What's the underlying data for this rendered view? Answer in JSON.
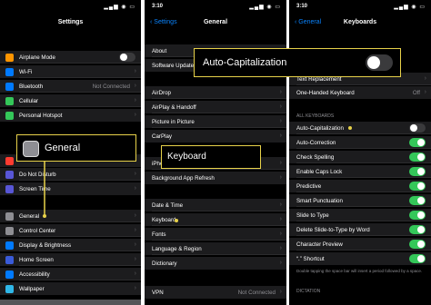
{
  "panel1": {
    "time": "",
    "title": "Settings",
    "group1": [
      {
        "label": "Airplane Mode",
        "icon": "airplane-icon",
        "color": "#ff9500",
        "toggle": "off"
      },
      {
        "label": "Wi-Fi",
        "icon": "wifi-icon",
        "color": "#007aff"
      },
      {
        "label": "Bluetooth",
        "icon": "bluetooth-icon",
        "color": "#007aff",
        "value": "Not Connected"
      },
      {
        "label": "Cellular",
        "icon": "cellular-icon",
        "color": "#34c759"
      },
      {
        "label": "Personal Hotspot",
        "icon": "hotspot-icon",
        "color": "#34c759"
      }
    ],
    "group2": [
      {
        "label": "Do Not Disturb",
        "icon": "moon-icon",
        "color": "#5856d6"
      },
      {
        "label": "Screen Time",
        "icon": "hourglass-icon",
        "color": "#5856d6"
      }
    ],
    "group3": [
      {
        "label": "General",
        "icon": "gear-icon",
        "color": "#8e8e93"
      },
      {
        "label": "Control Center",
        "icon": "control-center-icon",
        "color": "#8e8e93"
      },
      {
        "label": "Display & Brightness",
        "icon": "display-icon",
        "color": "#007aff"
      },
      {
        "label": "Home Screen",
        "icon": "home-screen-icon",
        "color": "#3a5bd9"
      },
      {
        "label": "Accessibility",
        "icon": "accessibility-icon",
        "color": "#007aff"
      },
      {
        "label": "Wallpaper",
        "icon": "wallpaper-icon",
        "color": "#2fb7e8"
      }
    ],
    "callout": "General"
  },
  "panel2": {
    "time": "3:10",
    "back": "Settings",
    "title": "General",
    "group1": [
      {
        "label": "About"
      },
      {
        "label": "Software Update"
      }
    ],
    "group2": [
      {
        "label": "AirDrop"
      },
      {
        "label": "AirPlay & Handoff"
      },
      {
        "label": "Picture in Picture"
      },
      {
        "label": "CarPlay"
      }
    ],
    "group3": [
      {
        "label": "iPhone Storage"
      },
      {
        "label": "Background App Refresh"
      }
    ],
    "group4": [
      {
        "label": "Date & Time"
      },
      {
        "label": "Keyboard"
      },
      {
        "label": "Fonts"
      },
      {
        "label": "Language & Region"
      },
      {
        "label": "Dictionary"
      }
    ],
    "group5": [
      {
        "label": "VPN",
        "value": "Not Connected"
      }
    ],
    "callout": "Keyboard"
  },
  "panel3": {
    "time": "3:10",
    "back": "General",
    "title": "Keyboards",
    "group1": [
      {
        "label": "Text Replacement"
      },
      {
        "label": "One-Handed Keyboard",
        "value": "Off"
      }
    ],
    "all_header": "ALL KEYBOARDS",
    "toggles": [
      {
        "label": "Auto-Capitalization",
        "state": "off"
      },
      {
        "label": "Auto-Correction",
        "state": "on"
      },
      {
        "label": "Check Spelling",
        "state": "on"
      },
      {
        "label": "Enable Caps Lock",
        "state": "on"
      },
      {
        "label": "Predictive",
        "state": "on"
      },
      {
        "label": "Smart Punctuation",
        "state": "on"
      },
      {
        "label": "Slide to Type",
        "state": "on"
      },
      {
        "label": "Delete Slide-to-Type by Word",
        "state": "on"
      },
      {
        "label": "Character Preview",
        "state": "on"
      },
      {
        "label": "“.” Shortcut",
        "state": "on"
      }
    ],
    "footnote": "Double tapping the space bar will insert a period followed by a space.",
    "dictation_header": "DICTATION",
    "callout": "Auto-Capitalization"
  }
}
